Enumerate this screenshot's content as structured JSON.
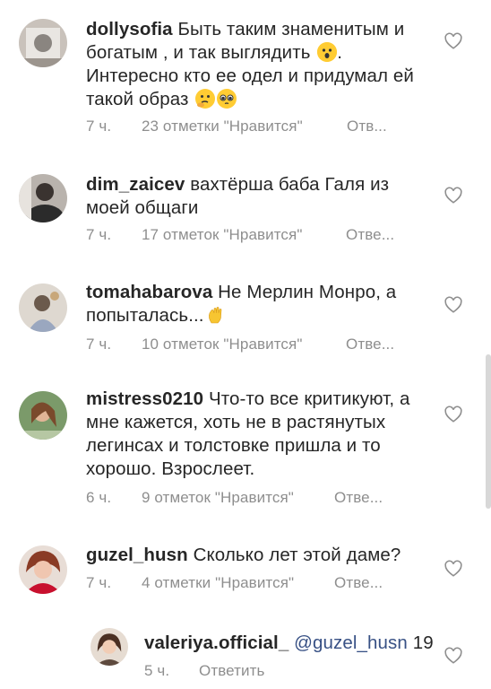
{
  "comments": [
    {
      "username": "dollysofia",
      "text_parts": [
        "Быть таким знаменитым и богатым , и так выглядить",
        ". Интересно кто ее одел и придумал ей такой образ"
      ],
      "time": "7 ч.",
      "likes": "23 отметки \"Нравится\"",
      "reply": "Отв...",
      "emojis": [
        "astonished-face-emoji",
        "thinking-face-emoji",
        "pleading-face-emoji"
      ]
    },
    {
      "username": "dim_zaicev",
      "text": "вахтёрша баба Галя из моей общаги",
      "time": "7 ч.",
      "likes": "17 отметок \"Нравится\"",
      "reply": "Отве..."
    },
    {
      "username": "tomahabarova",
      "text": "Не Мерлин Монро, а попыталась...",
      "time": "7 ч.",
      "likes": "10 отметок \"Нравится\"",
      "reply": "Отве...",
      "emojis": [
        "waving-hand-emoji"
      ]
    },
    {
      "username": "mistress0210",
      "text": "Что-то все критикуют, а мне кажется, хоть не в растянутых легинсах и толстовке пришла и то хорошо. Взрослеет.",
      "time": "6 ч.",
      "likes": "9 отметок \"Нравится\"",
      "reply": "Отве..."
    },
    {
      "username": "guzel_husn",
      "text": "Сколько лет этой даме?",
      "time": "7 ч.",
      "likes": "4 отметки \"Нравится\"",
      "reply": "Отве..."
    }
  ],
  "reply_comment": {
    "username": "valeriya.official_",
    "mention": "@guzel_husn",
    "text": "19",
    "time": "5 ч.",
    "reply": "Ответить"
  }
}
